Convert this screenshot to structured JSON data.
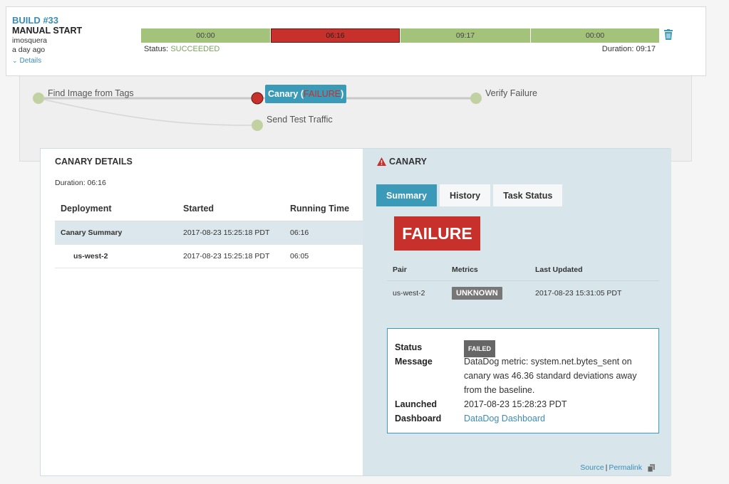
{
  "build": {
    "title": "BUILD #33",
    "trigger": "MANUAL START",
    "user": "imosquera",
    "time_ago": "a day ago",
    "details_label": "Details",
    "stages": [
      {
        "time": "00:00",
        "status": "ok"
      },
      {
        "time": "06:16",
        "status": "fail"
      },
      {
        "time": "09:17",
        "status": "ok"
      },
      {
        "time": "00:00",
        "status": "ok"
      }
    ],
    "status_label": "Status:",
    "status_value": "SUCCEEDED",
    "duration_text": "Duration: 09:17",
    "colors": {
      "success": "#a3c27a",
      "failure": "#c8312b",
      "accent": "#3a9ab8"
    }
  },
  "graph": {
    "nodes": {
      "find_image": "Find Image from Tags",
      "canary_label": "Canary",
      "canary_open": " (",
      "canary_status": "FAILURE",
      "canary_close": ")",
      "verify": "Verify Failure",
      "send_traffic": "Send Test Traffic"
    }
  },
  "canary_details": {
    "title": "CANARY DETAILS",
    "duration": "Duration: 06:16",
    "columns": [
      "Deployment",
      "Started",
      "Running Time"
    ],
    "rows": [
      {
        "deployment": "Canary Summary",
        "started": "2017-08-23 15:25:18 PDT",
        "running": "06:16"
      },
      {
        "deployment": "us-west-2",
        "started": "2017-08-23 15:25:18 PDT",
        "running": "06:05"
      }
    ]
  },
  "canary_panel": {
    "title": "CANARY",
    "tabs": [
      "Summary",
      "History",
      "Task Status"
    ],
    "result": "FAILURE",
    "pair_columns": [
      "Pair",
      "Metrics",
      "Last Updated"
    ],
    "pair_row": {
      "pair": "us-west-2",
      "metrics": "UNKNOWN",
      "updated": "2017-08-23 15:31:05 PDT"
    },
    "status_box": {
      "status_label": "Status",
      "status_value": "FAILED",
      "message_label": "Message",
      "message_value": "DataDog metric: system.net.bytes_sent on canary was 46.36 standard deviations away from the baseline.",
      "launched_label": "Launched",
      "launched_value": "2017-08-23 15:28:23 PDT",
      "dashboard_label": "Dashboard",
      "dashboard_value": "DataDog Dashboard"
    },
    "footer": {
      "source": "Source",
      "separator": "|",
      "permalink": "Permalink"
    }
  }
}
